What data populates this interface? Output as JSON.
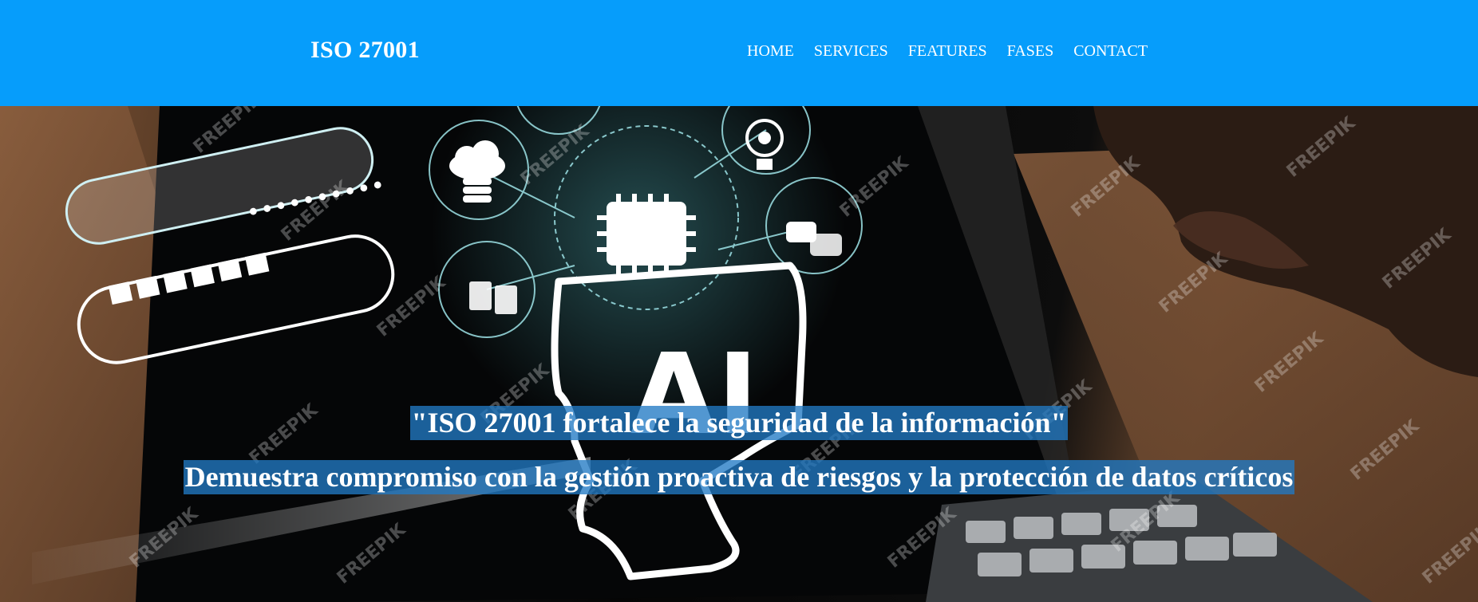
{
  "header": {
    "logo": "ISO 27001",
    "background_color": "#069dfb",
    "nav": [
      {
        "label": "HOME"
      },
      {
        "label": "SERVICES"
      },
      {
        "label": "FEATURES"
      },
      {
        "label": "FASES"
      },
      {
        "label": "CONTACT"
      }
    ]
  },
  "hero": {
    "headline": "\"ISO 27001 fortalece la seguridad de la información\"",
    "subheadline": "Demuestra compromiso con la gestión proactiva de riesgos y la protección de datos críticos",
    "highlight_color": "#217ac4",
    "image_chip_text": "AI",
    "image_password_dots": "••••••••••",
    "watermark": "FREEPIK"
  }
}
